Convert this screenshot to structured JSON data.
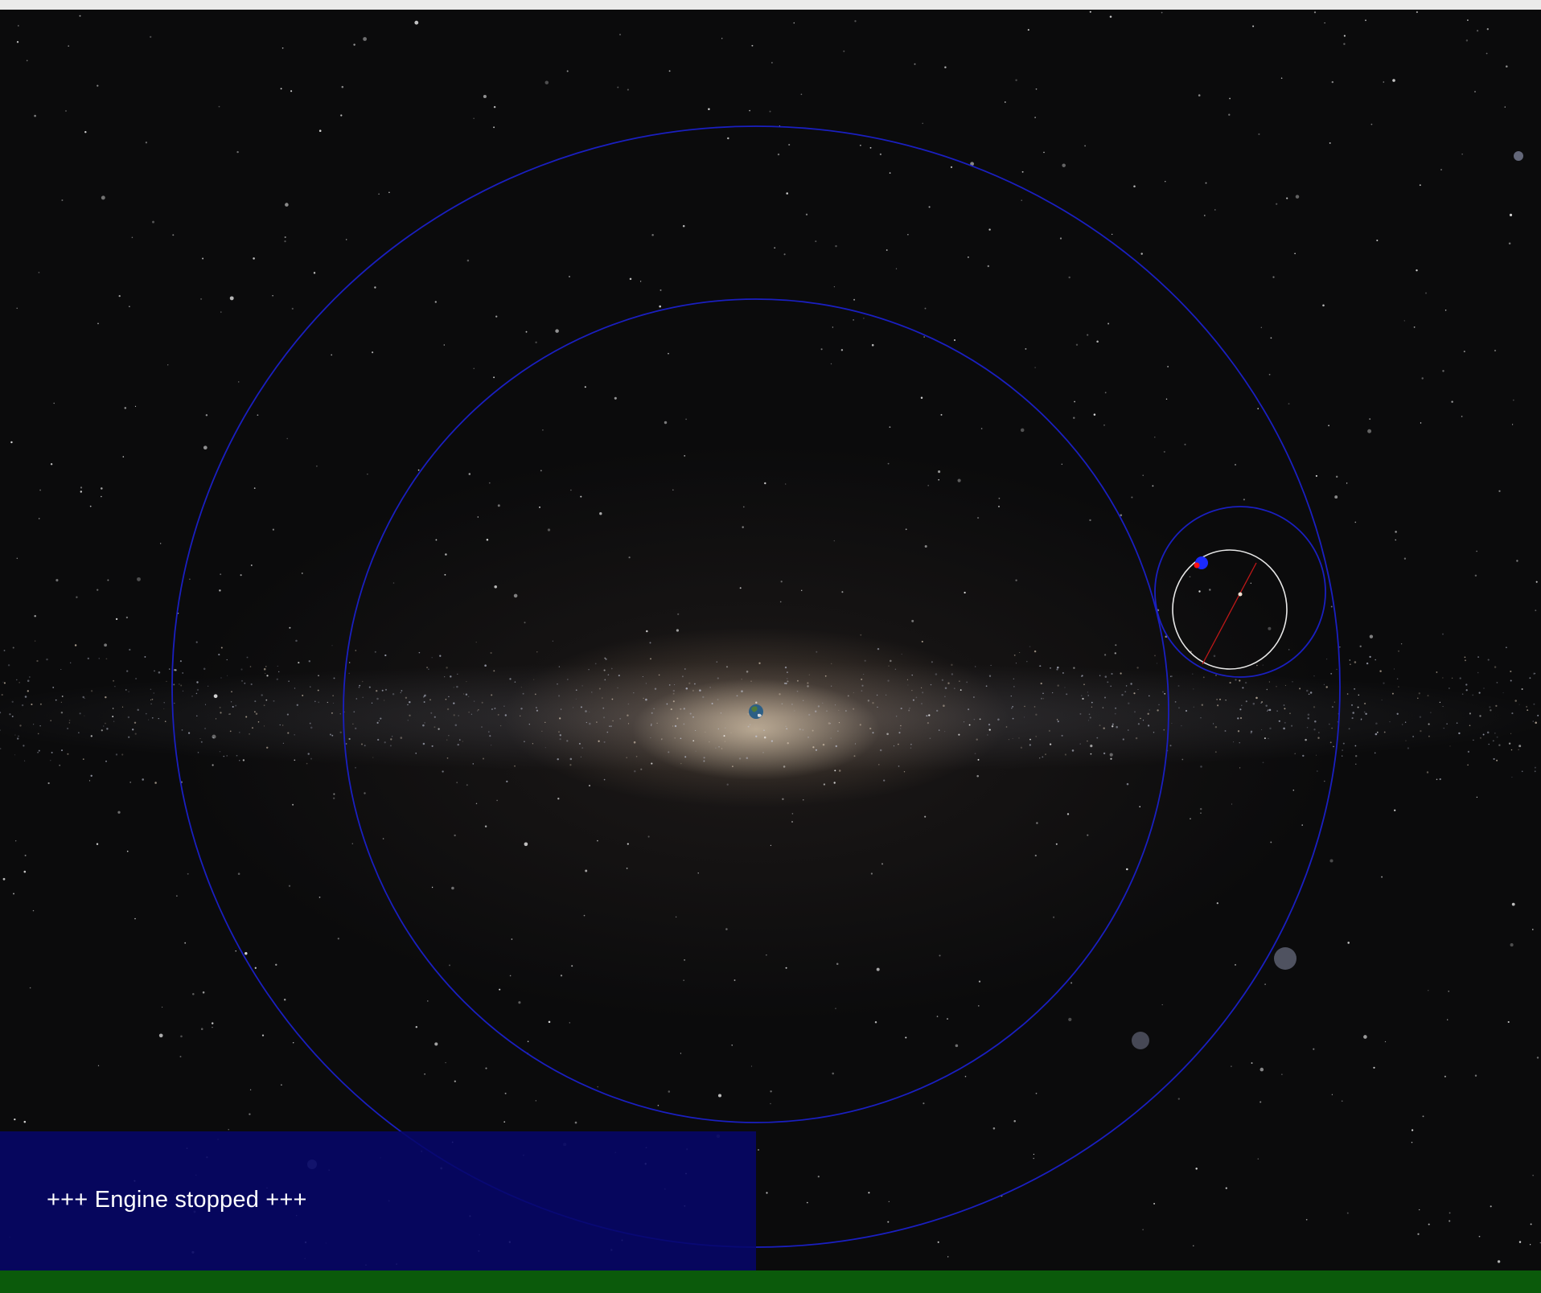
{
  "status": {
    "message": "+++ Engine stopped +++"
  },
  "bodies": [
    {
      "name": "earth",
      "icon": "earth-icon"
    },
    {
      "name": "spacecraft",
      "icon": "spacecraft-icon"
    },
    {
      "name": "moon",
      "icon": "moon-icon"
    }
  ],
  "colors": {
    "orbit": "#1a1fc0",
    "moon_orbit": "#e8e8e8",
    "trajectory_line": "#c01818",
    "spacecraft": "#1a2aff",
    "spacecraft_marker": "#ff1010",
    "status_panel": "#060669",
    "bottom_bar": "#0b5a0b",
    "top_strip": "#ebebea"
  }
}
